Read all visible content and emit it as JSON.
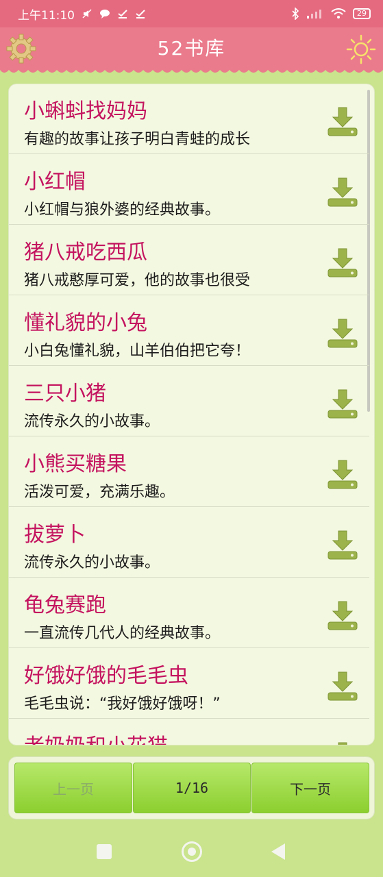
{
  "status_bar": {
    "time": "上午11:10",
    "notification_icons": [
      "mute-icon",
      "chat-icon",
      "check-icon",
      "check-icon"
    ],
    "battery": "29"
  },
  "header": {
    "title": "52书库"
  },
  "list": {
    "items": [
      {
        "title": "小蝌蚪找妈妈",
        "desc": "有趣的故事让孩子明白青蛙的成长"
      },
      {
        "title": "小红帽",
        "desc": "小红帽与狼外婆的经典故事。"
      },
      {
        "title": "猪八戒吃西瓜",
        "desc": "猪八戒憨厚可爱，他的故事也很受"
      },
      {
        "title": "懂礼貌的小兔",
        "desc": "小白兔懂礼貌，山羊伯伯把它夸！"
      },
      {
        "title": "三只小猪",
        "desc": "流传永久的小故事。"
      },
      {
        "title": "小熊买糖果",
        "desc": "活泼可爱，充满乐趣。"
      },
      {
        "title": "拔萝卜",
        "desc": "流传永久的小故事。"
      },
      {
        "title": "龟兔赛跑",
        "desc": "一直流传几代人的经典故事。"
      },
      {
        "title": "好饿好饿的毛毛虫",
        "desc": "毛毛虫说：“我好饿好饿呀！”"
      },
      {
        "title": "老奶奶和小花猫",
        "desc": ""
      }
    ]
  },
  "pager": {
    "prev_label": "上一页",
    "page_indicator": "1/16",
    "next_label": "下一页"
  },
  "colors": {
    "accent": "#e56a80",
    "title_text": "#c4135f",
    "background": "#c9e48c"
  }
}
